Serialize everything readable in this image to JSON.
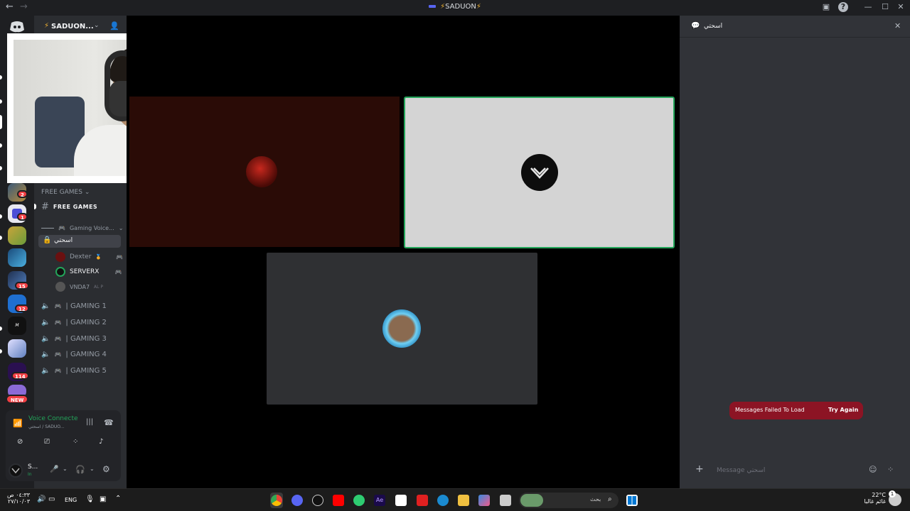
{
  "window": {
    "title": "SADUON",
    "back_icon": "back-arrow-icon",
    "forward_icon": "forward-arrow-icon"
  },
  "server": {
    "name": "SADUON...",
    "discord_icon": "discord-icon"
  },
  "rail_badges": [
    "2",
    "1",
    "15",
    "12",
    "114"
  ],
  "rail_new_label": "NEW",
  "channels": {
    "category_free_games": "FREE GAMES",
    "free_games_channel": "FREE  GAMES",
    "gaming_voice_category": "Gaming Voice...",
    "active_voice_channel": "اسحتي",
    "members": [
      {
        "name": "Dexter"
      },
      {
        "name": "SERVERX"
      },
      {
        "name": "VNDA7"
      }
    ],
    "member_tags": [
      "AL P"
    ],
    "voice_channels": [
      "| GAMING 1",
      "| GAMING 2",
      "| GAMING 3",
      "| GAMING 4",
      "| GAMING 5"
    ]
  },
  "voice_panel": {
    "status": "Voice Connecte",
    "location": "اسحتي / SADUO..."
  },
  "user_panel": {
    "name": "S...",
    "status": "In"
  },
  "chat": {
    "channel_name": "اسحتي",
    "error_text": "Messages Failed To Load",
    "try_again": "Try Again",
    "input_placeholder": "Message اسحتي"
  },
  "taskbar": {
    "time": "٠٤:٣٣ ص",
    "date": "٢٧/١٠/٠٣",
    "language": "ENG",
    "search_placeholder": "بحث",
    "weather_temp": "22°C",
    "weather_desc": "غائم غالبا",
    "notification_count": "1"
  },
  "colors": {
    "accent": "#5865f2",
    "danger": "#f23f43",
    "speaking": "#23a55a",
    "error_bg": "#8c1424"
  }
}
